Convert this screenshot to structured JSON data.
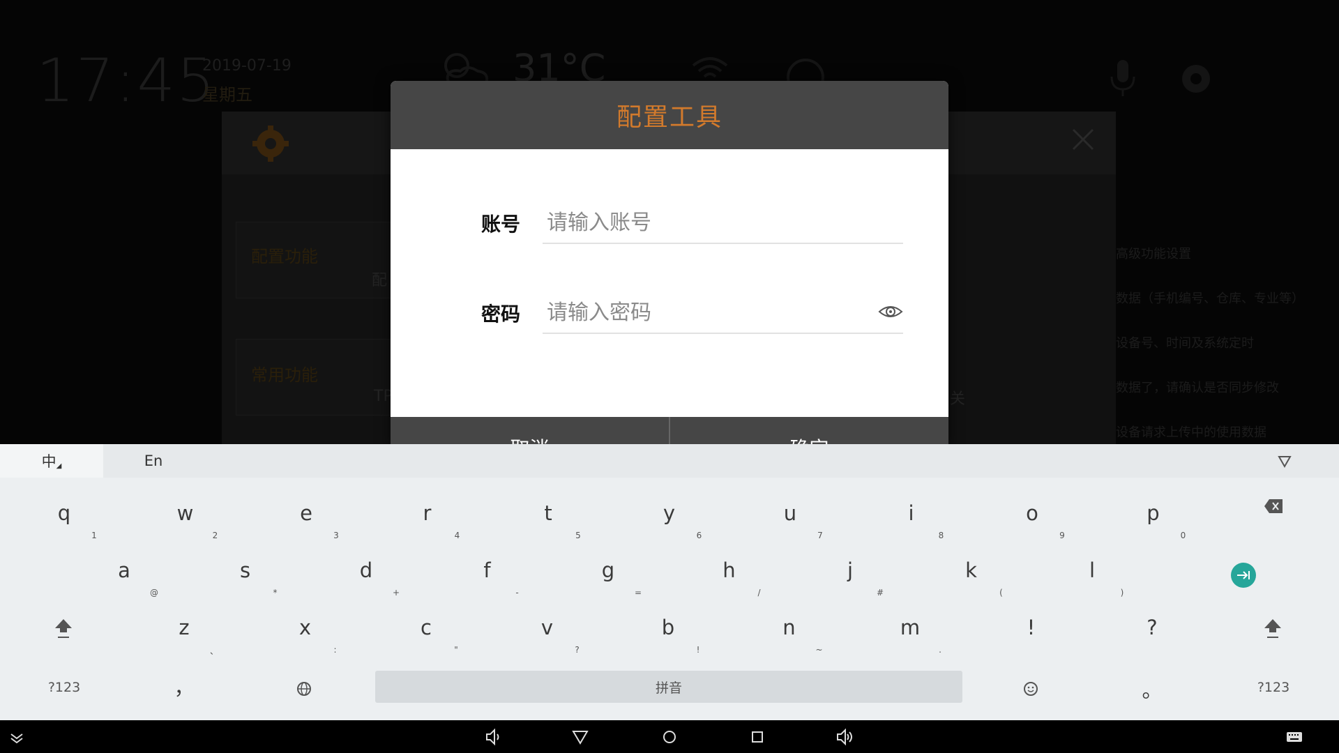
{
  "background": {
    "clock": "17:45",
    "date": "2019-07-19",
    "weekday": "星期五",
    "temperature": "31°C",
    "config_label": "配置功能",
    "config_sub": "配",
    "common_label": "常用功能",
    "tp_text": "TP",
    "guan_text": "关",
    "side_lines": [
      "高级功能设置",
      "数据（手机编号、仓库、专业等）",
      "设备号、时间及系统定时",
      "数据了，请确认是否同步修改",
      "设备请求上传中的使用数据"
    ]
  },
  "dialog": {
    "title": "配置工具",
    "account_label": "账号",
    "account_placeholder": "请输入账号",
    "password_label": "密码",
    "password_placeholder": "请输入密码",
    "cancel_label": "取消",
    "confirm_label": "确定"
  },
  "keyboard": {
    "tabs": {
      "chinese": "中",
      "english": "En"
    },
    "row1": [
      {
        "k": "q",
        "s": "1"
      },
      {
        "k": "w",
        "s": "2"
      },
      {
        "k": "e",
        "s": "3"
      },
      {
        "k": "r",
        "s": "4"
      },
      {
        "k": "t",
        "s": "5"
      },
      {
        "k": "y",
        "s": "6"
      },
      {
        "k": "u",
        "s": "7"
      },
      {
        "k": "i",
        "s": "8"
      },
      {
        "k": "o",
        "s": "9"
      },
      {
        "k": "p",
        "s": "0"
      }
    ],
    "row2": [
      {
        "k": "a",
        "s": "@"
      },
      {
        "k": "s",
        "s": "*"
      },
      {
        "k": "d",
        "s": "+"
      },
      {
        "k": "f",
        "s": "-"
      },
      {
        "k": "g",
        "s": "="
      },
      {
        "k": "h",
        "s": "/"
      },
      {
        "k": "j",
        "s": "#"
      },
      {
        "k": "k",
        "s": "("
      },
      {
        "k": "l",
        "s": ")"
      }
    ],
    "row3": [
      {
        "k": "z",
        "s": "、"
      },
      {
        "k": "x",
        "s": ":"
      },
      {
        "k": "c",
        "s": "\""
      },
      {
        "k": "v",
        "s": "?"
      },
      {
        "k": "b",
        "s": "!"
      },
      {
        "k": "n",
        "s": "~"
      },
      {
        "k": "m",
        "s": "."
      },
      {
        "k": "!",
        "s": ""
      },
      {
        "k": "?",
        "s": ""
      }
    ],
    "symbols_label": "?123",
    "comma": "，",
    "space_label": "拼音",
    "period": "。"
  },
  "icons": {
    "backspace": "backspace-icon",
    "enter": "enter-icon",
    "shift": "shift-icon",
    "globe": "globe-icon",
    "emoji": "emoji-icon",
    "eye": "eye-icon",
    "collapse": "collapse-keyboard-icon"
  },
  "colors": {
    "accent_orange": "#d27a2c",
    "enter_teal": "#26a69a",
    "dialog_header": "#464646"
  }
}
